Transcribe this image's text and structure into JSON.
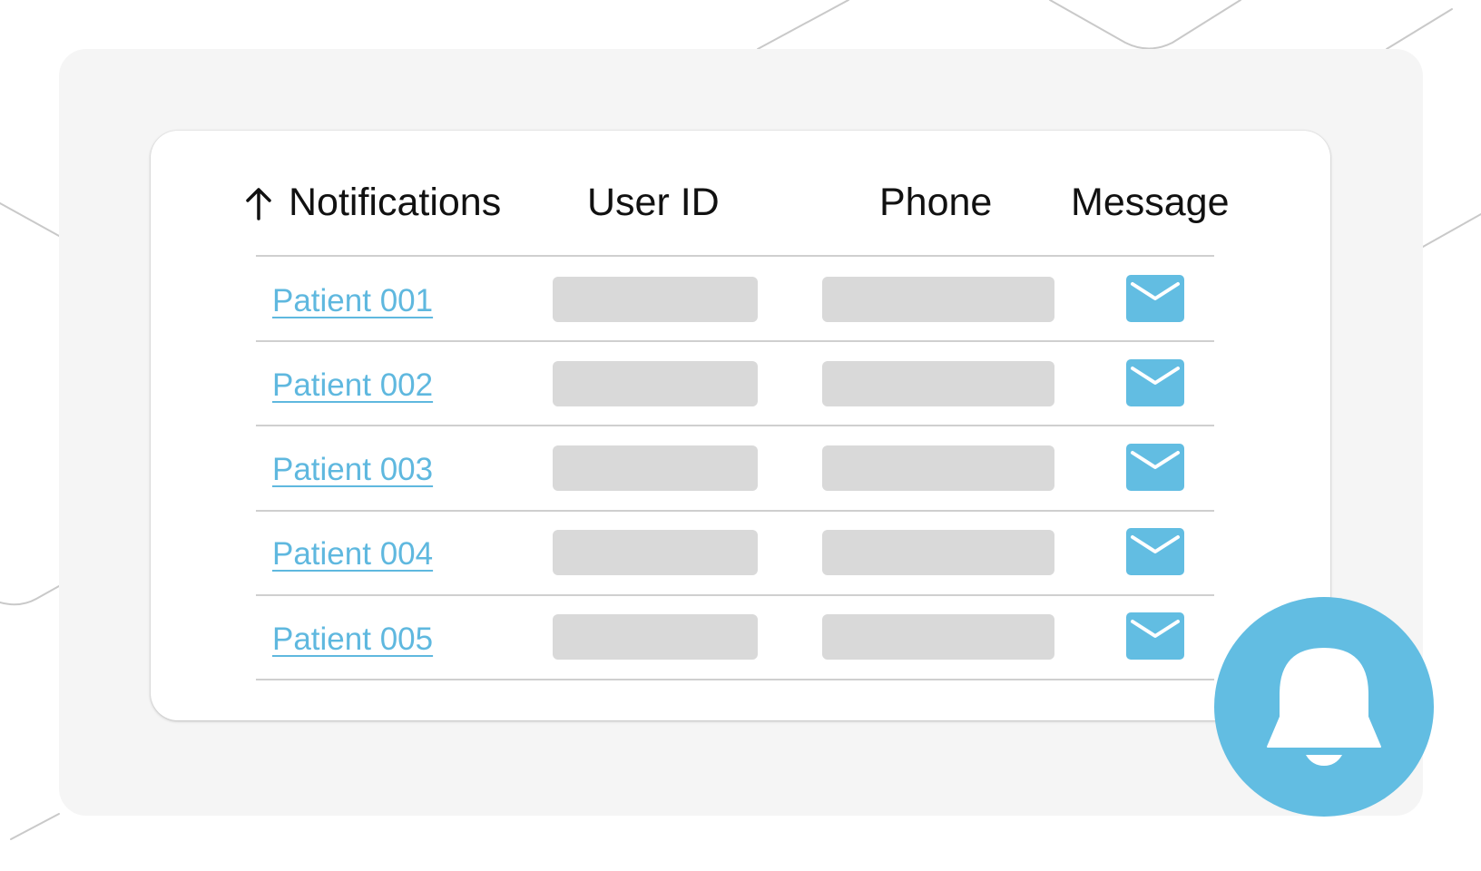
{
  "table": {
    "columns": {
      "notifications": "Notifications",
      "user_id": "User ID",
      "phone": "Phone",
      "message": "Message"
    },
    "sort_icon": "arrow-up-icon",
    "rows": [
      {
        "patient": "Patient 001",
        "message_icon": "envelope-icon"
      },
      {
        "patient": "Patient 002",
        "message_icon": "envelope-icon"
      },
      {
        "patient": "Patient 003",
        "message_icon": "envelope-icon"
      },
      {
        "patient": "Patient 004",
        "message_icon": "envelope-icon"
      },
      {
        "patient": "Patient 005",
        "message_icon": "envelope-icon"
      }
    ]
  },
  "notification_button": {
    "icon": "bell-icon"
  },
  "colors": {
    "accent": "#62bde2",
    "link": "#5fb8df",
    "placeholder": "#d9d9d9",
    "panel": "#f5f5f5",
    "text": "#111111"
  }
}
